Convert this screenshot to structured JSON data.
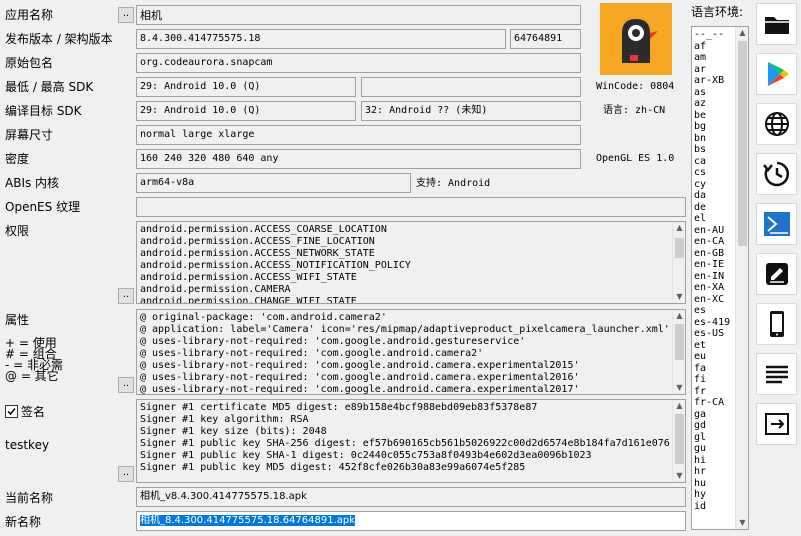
{
  "labels": {
    "app_name": "应用名称",
    "version": "发布版本 / 架构版本",
    "package": "原始包名",
    "min_max_sdk": "最低 / 最高 SDK",
    "target_sdk": "编译目标 SDK",
    "screen": "屏幕尺寸",
    "density": "密度",
    "abis": "ABIs 内核",
    "opengl_tex": "OpenES 纹理",
    "permissions": "权限",
    "attributes": "属性",
    "legend_plus": "+ = 使用",
    "legend_hash": "# = 组合",
    "legend_minus": "- = 非必需",
    "legend_at": "@ = 其它",
    "signature": "签名",
    "testkey": "testkey",
    "current_name": "当前名称",
    "new_name": "新名称",
    "language_env": "语言环境:",
    "dots": ".."
  },
  "values": {
    "app_name": "相机",
    "version": "8.4.300.414775575.18",
    "version_code": "64764891",
    "package": "org.codeaurora.snapcam",
    "min_sdk": "29: Android 10.0 (Q)",
    "max_sdk": "",
    "target_sdk": "29: Android 10.0 (Q)",
    "compile_sdk": "32: Android ?? (未知)",
    "screen": "normal large xlarge",
    "density": "160 240 320 480 640 any",
    "abis": "arm64-v8a",
    "support": "支持: Android",
    "opengl_tex": "",
    "wincode": "WinCode: 0804",
    "language": "语言: zh-CN",
    "opengl": "OpenGL ES 1.0",
    "current_name": "相机_v8.4.300.414775575.18.apk",
    "new_name": "相机_8.4.300.414775575.18.64764891.apk"
  },
  "permissions": [
    "android.permission.ACCESS_COARSE_LOCATION",
    "android.permission.ACCESS_FINE_LOCATION",
    "android.permission.ACCESS_NETWORK_STATE",
    "android.permission.ACCESS_NOTIFICATION_POLICY",
    "android.permission.ACCESS_WIFI_STATE",
    "android.permission.CAMERA",
    "android.permission.CHANGE_WIFI_STATE"
  ],
  "attributes": [
    "@ original-package: 'com.android.camera2'",
    "@ application: label='Camera' icon='res/mipmap/adaptiveproduct_pixelcamera_launcher.xml'",
    "@ uses-library-not-required: 'com.google.android.gestureservice'",
    "@ uses-library-not-required: 'com.google.android.camera2'",
    "@ uses-library-not-required: 'com.google.android.camera.experimental2015'",
    "@ uses-library-not-required: 'com.google.android.camera.experimental2016'",
    "@ uses-library-not-required: 'com.google.android.camera.experimental2017'"
  ],
  "signature_lines": [
    "Signer #1 certificate MD5 digest: e89b158e4bcf988ebd09eb83f5378e87",
    "Signer #1 key algorithm: RSA",
    "Signer #1 key size (bits): 2048",
    "Signer #1 public key SHA-256 digest: ef57b690165cb561b5026922c00d2d6574e8b184fa7d161e076",
    "Signer #1 public key SHA-1 digest: 0c2440c055c753a8f0493b4e602d3ea0096b1023",
    "Signer #1 public key MD5 digest: 452f8cfe026b30a83e99a6074e5f285"
  ],
  "languages": [
    "--_--",
    "af",
    "am",
    "ar",
    "ar-XB",
    "as",
    "az",
    "be",
    "bg",
    "bn",
    "bs",
    "ca",
    "cs",
    "cy",
    "da",
    "de",
    "el",
    "en-AU",
    "en-CA",
    "en-GB",
    "en-IE",
    "en-IN",
    "en-XA",
    "en-XC",
    "es",
    "es-419",
    "es-US",
    "et",
    "eu",
    "fa",
    "fi",
    "fr",
    "fr-CA",
    "ga",
    "gd",
    "gl",
    "gu",
    "hi",
    "hr",
    "hu",
    "hy",
    "id"
  ],
  "toolbar": [
    {
      "name": "open-folder-button",
      "icon": "folder-icon"
    },
    {
      "name": "google-play-button",
      "icon": "play-store-icon"
    },
    {
      "name": "web-button",
      "icon": "globe-icon"
    },
    {
      "name": "history-button",
      "icon": "history-icon"
    },
    {
      "name": "terminal-button",
      "icon": "terminal-icon"
    },
    {
      "name": "edit-button",
      "icon": "edit-icon"
    },
    {
      "name": "device-button",
      "icon": "phone-icon"
    },
    {
      "name": "list-button",
      "icon": "list-icon"
    },
    {
      "name": "export-button",
      "icon": "export-icon"
    }
  ],
  "colors": {
    "icon_bg": "#f5a623",
    "selection": "#0078d7",
    "play_green": "#00c26b",
    "play_blue": "#2196f3",
    "play_red": "#ea4335",
    "play_yellow": "#fbbc04"
  }
}
